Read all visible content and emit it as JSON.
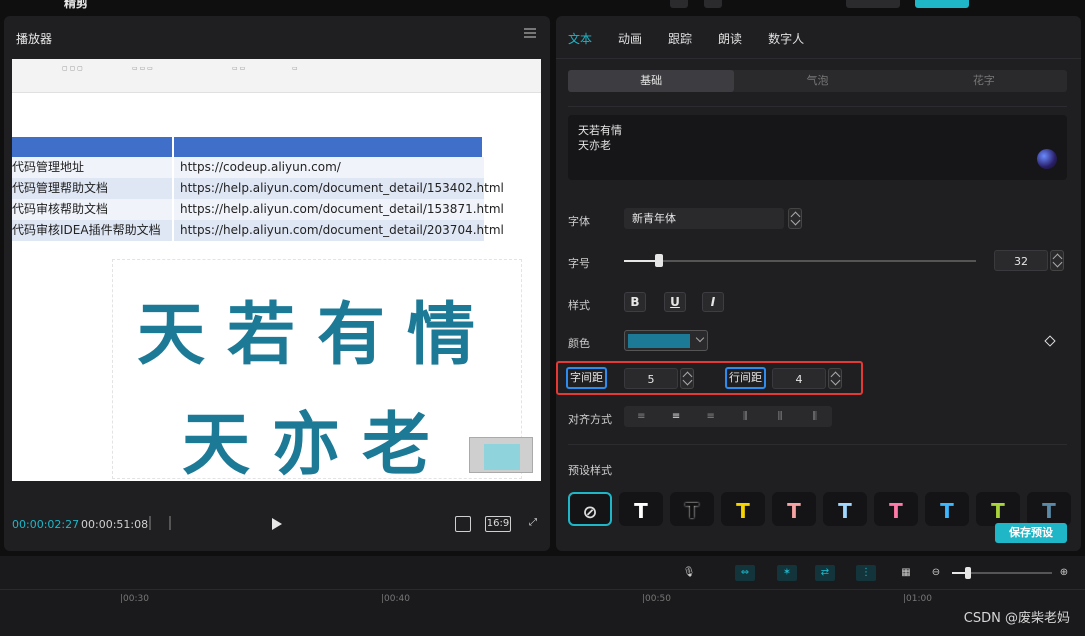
{
  "topbar": {
    "title": "精剪"
  },
  "player": {
    "title": "播放器",
    "current_time": "00:00:02:27",
    "total_time": "00:00:51:08",
    "ratio": "16:9",
    "table_rows": [
      [
        "代码管理地址",
        "https://codeup.aliyun.com/"
      ],
      [
        "代码管理帮助文档",
        "https://help.aliyun.com/document_detail/153402.html"
      ],
      [
        "代码审核帮助文档",
        "https://help.aliyun.com/document_detail/153871.html"
      ],
      [
        "代码审核IDEA插件帮助文档",
        "https://help.aliyun.com/document_detail/203704.html"
      ]
    ],
    "overlay_line1": "天若有情",
    "overlay_line2": "天亦老"
  },
  "props": {
    "tabs": [
      "文本",
      "动画",
      "跟踪",
      "朗读",
      "数字人"
    ],
    "segments": [
      "基础",
      "气泡",
      "花字"
    ],
    "text_content": "天若有情\n天亦老",
    "font_label": "字体",
    "font_value": "新青年体",
    "size_label": "字号",
    "size_value": "32",
    "size_fraction": 0.1,
    "style_label": "样式",
    "style_buttons": [
      "B",
      "U",
      "I"
    ],
    "color_label": "颜色",
    "color_value": "#1c7a96",
    "char_spacing_label": "字间距",
    "char_spacing_value": "5",
    "line_spacing_label": "行间距",
    "line_spacing_value": "4",
    "align_label": "对齐方式",
    "preset_label": "预设样式",
    "save_preset_label": "保存预设"
  },
  "timeline": {
    "marks": [
      "|00:30",
      "|00:40",
      "|00:50",
      "|01:00"
    ]
  },
  "watermark": "CSDN @废柴老妈"
}
